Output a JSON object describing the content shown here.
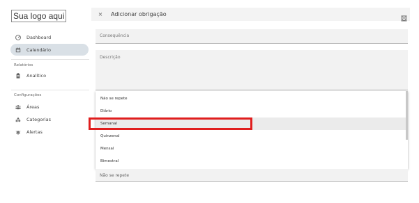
{
  "sidebar": {
    "logo": "Sua logo aqui",
    "items": [
      {
        "label": "Dashboard",
        "icon": "dashboard-icon"
      },
      {
        "label": "Calendário",
        "icon": "calendar-icon",
        "active": true
      }
    ],
    "sections": [
      {
        "title": "Relatórios",
        "items": [
          {
            "label": "Analítico",
            "icon": "clipboard-icon"
          }
        ]
      },
      {
        "title": "Configurações",
        "items": [
          {
            "label": "Áreas",
            "icon": "areas-icon"
          },
          {
            "label": "Categorias",
            "icon": "categories-icon"
          },
          {
            "label": "Alertas",
            "icon": "alerts-icon"
          }
        ]
      }
    ]
  },
  "header": {
    "close_label": "×",
    "title": "Adicionar obrigação",
    "save_icon": "save-icon"
  },
  "form": {
    "consequencia_label": "Consequência",
    "descricao_label": "Descrição",
    "recurrence_value": "Não se repete"
  },
  "dropdown": {
    "options": [
      "Não se repete",
      "Diário",
      "Semanal",
      "Quinzenal",
      "Mensal",
      "Bimestral"
    ],
    "hovered": "Semanal"
  },
  "colors": {
    "active_nav": "#d9e0e6",
    "highlight": "#e01e1e"
  }
}
